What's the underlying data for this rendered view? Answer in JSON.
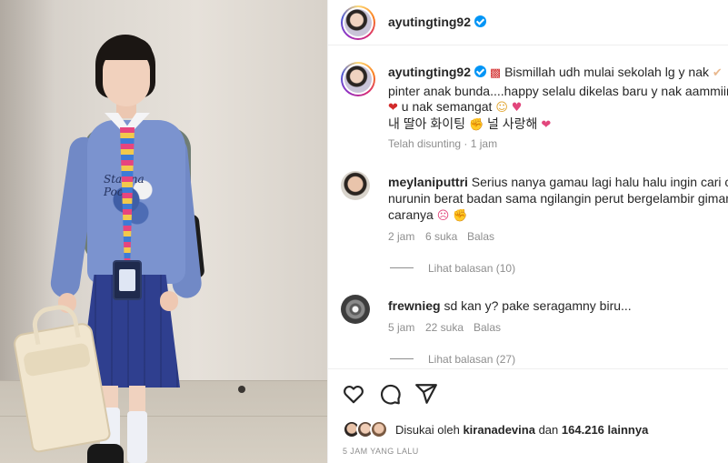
{
  "post": {
    "username": "ayutingting92",
    "caption_lines": [
      "Bismillah udh mulai sekolah lg y nak",
      "pinter anak bunda....happy selalu dikelas baru y nak aammiinn",
      "u nak semangat",
      "내 딸아 화이팅",
      "널 사랑해"
    ],
    "caption_meta": "Telah disunting · 1 jam"
  },
  "photo": {
    "shirt_print": "Starina Pooh"
  },
  "comments": [
    {
      "username": "meylaniputtri",
      "text_lines": [
        "Serius nanya gamau lagi halu halu ingin cari cara",
        "nurunin berat badan sama ngilangin perut bergelambir gimana",
        "caranya"
      ],
      "time": "2 jam",
      "likes": "6 suka",
      "reply": "Balas",
      "view_replies": "Lihat balasan (10)"
    },
    {
      "username": "frewnieg",
      "text_lines": [
        "sd kan y? pake seragamny biru..."
      ],
      "time": "5 jam",
      "likes": "22 suka",
      "reply": "Balas",
      "view_replies": "Lihat balasan (27)"
    }
  ],
  "likes": {
    "prefix": "Disukai oleh",
    "user": "kiranadevina",
    "middle": "dan",
    "count": "164.216 lainnya"
  },
  "timestamp": "5 JAM YANG LALU",
  "icons": {
    "like": "heart-icon",
    "comment": "comment-icon",
    "share": "share-icon",
    "verified": "verified-badge-icon"
  },
  "colors": {
    "verified": "#0095f6",
    "text": "#262626",
    "meta": "#8e8e8e"
  }
}
